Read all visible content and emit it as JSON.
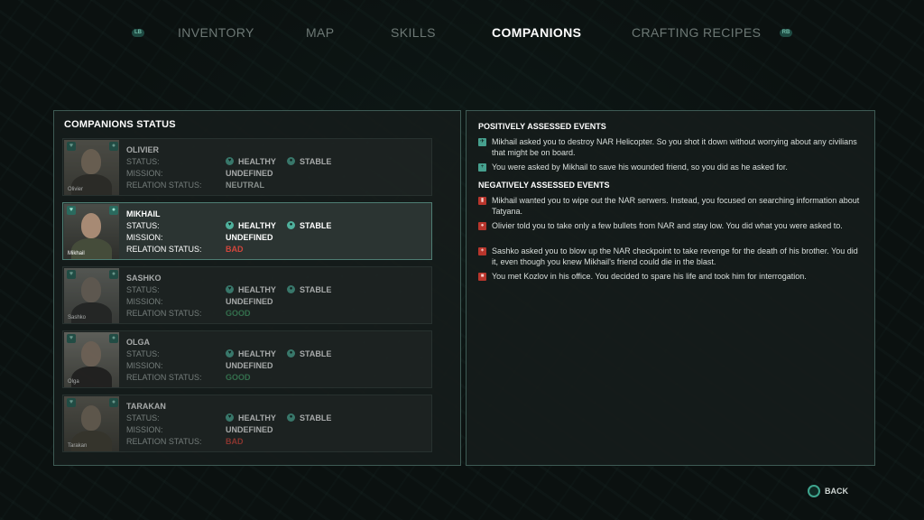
{
  "nav": {
    "lb": "LB",
    "rb": "RB",
    "tabs": [
      "INVENTORY",
      "MAP",
      "SKILLS",
      "COMPANIONS",
      "CRAFTING RECIPES"
    ],
    "active": "COMPANIONS"
  },
  "companions_panel": {
    "title": "COMPANIONS STATUS",
    "labels": {
      "status": "STATUS:",
      "mission": "MISSION:",
      "relation": "RELATION STATUS:",
      "healthy": "HEALTHY",
      "stable": "STABLE"
    },
    "companions": [
      {
        "name": "OLIVIER",
        "portrait_name": "Olivier",
        "mission": "UNDEFINED",
        "relation": "NEUTRAL"
      },
      {
        "name": "MIKHAIL",
        "portrait_name": "Mikhail",
        "mission": "UNDEFINED",
        "relation": "BAD"
      },
      {
        "name": "SASHKO",
        "portrait_name": "Sashko",
        "mission": "UNDEFINED",
        "relation": "GOOD"
      },
      {
        "name": "OLGA",
        "portrait_name": "Olga",
        "mission": "UNDEFINED",
        "relation": "GOOD"
      },
      {
        "name": "TARAKAN",
        "portrait_name": "Tarakan",
        "mission": "UNDEFINED",
        "relation": "BAD"
      }
    ],
    "selected": "MIKHAIL"
  },
  "events_panel": {
    "positive_title": "POSITIVELY ASSESSED EVENTS",
    "positive": [
      "Mikhail asked you to destroy NAR Helicopter. So you shot it down without worrying about any civilians that might be on board.",
      "You were asked by Mikhail to save his wounded friend, so you did as he asked for."
    ],
    "negative_title": "NEGATIVELY ASSESSED EVENTS",
    "negative": [
      "Mikhail wanted you to wipe out the NAR serwers. Instead, you focused on searching information about Tatyana.",
      "Olivier told you to take only a few bullets from NAR and stay low. You did what you were asked to.",
      "Sashko asked you to blow up the NAR checkpoint to take revenge for the death of his brother. You did it, even though you knew Mikhail's friend could die in the blast.",
      "You met Kozlov in his office. You decided to spare his life and took him for interrogation."
    ]
  },
  "footer": {
    "back_label": "BACK"
  },
  "colors": {
    "accent": "#4fb09c",
    "bad": "#d2463c",
    "good": "#47a26b",
    "panel_border": "#3e5a54"
  }
}
